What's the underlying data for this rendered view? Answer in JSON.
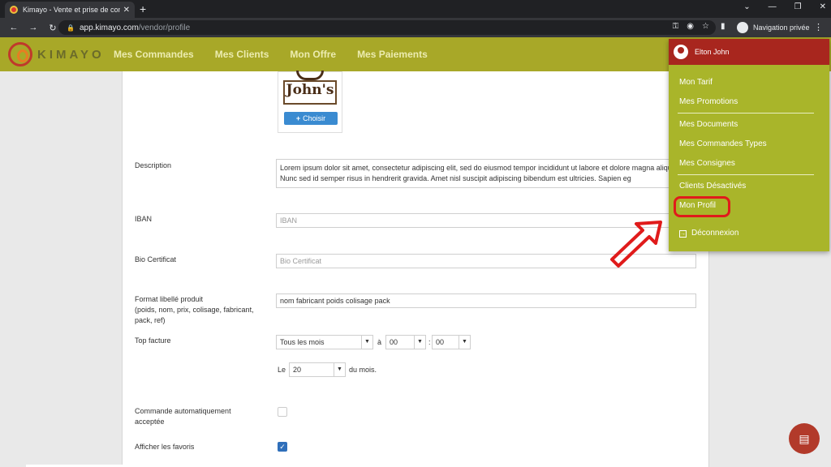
{
  "browser": {
    "tab_title": "Kimayo - Vente et prise de comm",
    "tab_close": "✕",
    "new_tab": "+",
    "url_host": "app.kimayo.com",
    "url_path": "/vendor/profile",
    "private_label": "Navigation privée"
  },
  "app": {
    "logo_text": "KIMAYO",
    "nav": [
      "Mes Commandes",
      "Mes Clients",
      "Mon Offre",
      "Mes Paiements"
    ]
  },
  "profile": {
    "logo_brand": "John's",
    "choose_label": "Choisir",
    "description_label": "Description",
    "description_value": "Lorem ipsum dolor sit amet, consectetur adipiscing elit, sed do eiusmod tempor incididunt ut labore et dolore magna aliqua. Nunc sed id semper risus in hendrerit gravida. Amet nisl suscipit adipiscing bibendum est ultricies. Sapien eg",
    "iban_label": "IBAN",
    "iban_placeholder": "IBAN",
    "bio_label": "Bio Certificat",
    "bio_placeholder": "Bio Certificat",
    "format_label": "Format libellé produit",
    "format_hint": "(poids, nom, prix, colisage, fabricant, pack, ref)",
    "format_value": "nom fabricant poids colisage pack",
    "top_facture_label": "Top facture",
    "frequency_value": "Tous les mois",
    "at_label": "à",
    "hour_value": "00",
    "colon": ":",
    "minute_value": "00",
    "day_prefix": "Le",
    "day_value": "20",
    "day_suffix": "du mois.",
    "auto_order_label": "Commande automatiquement acceptée",
    "favorites_label": "Afficher les favoris"
  },
  "menu": {
    "user_name": "Elton John",
    "items_group1": [
      "Mon Tarif",
      "Mes Promotions"
    ],
    "items_group2": [
      "Mes Documents",
      "Mes Commandes Types",
      "Mes Consignes"
    ],
    "items_group3": [
      "Clients Désactivés",
      "Mon Profil"
    ],
    "logout": "Déconnexion"
  },
  "colors": {
    "header": "#a8a828",
    "menu_bg": "#a9b52a",
    "menu_head": "#a8261e",
    "highlight": "#e01b1b"
  }
}
